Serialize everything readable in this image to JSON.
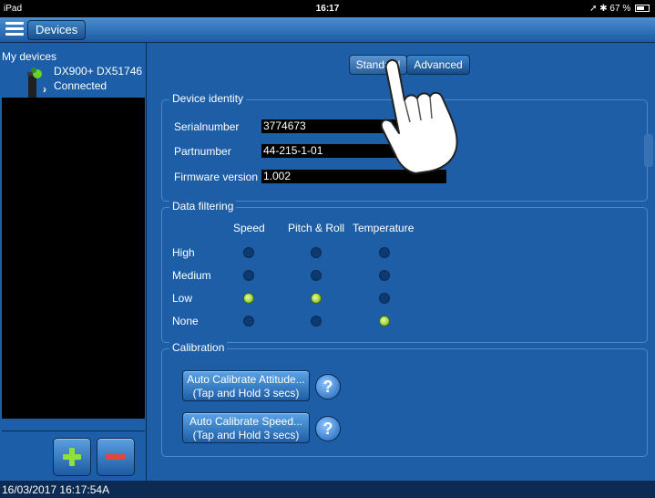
{
  "status_bar": {
    "device": "iPad",
    "time": "16:17",
    "battery": "67 %"
  },
  "toolbar": {
    "devices_label": "Devices"
  },
  "sidebar": {
    "title": "My devices",
    "device_name": "DX900+ DX51746",
    "device_status": "Connected"
  },
  "main": {
    "tabs": [
      "Standard",
      "Advanced"
    ],
    "identity": {
      "title": "Device identity",
      "rows": [
        {
          "label": "Serialnumber",
          "value": "3774673"
        },
        {
          "label": "Partnumber",
          "value": "44-215-1-01"
        },
        {
          "label": "Firmware version",
          "value": "1.002"
        }
      ]
    },
    "filtering": {
      "title": "Data filtering",
      "columns": [
        "Speed",
        "Pitch & Roll",
        "Temperature"
      ],
      "rows": [
        "High",
        "Medium",
        "Low",
        "None"
      ],
      "selected": {
        "Speed": "Low",
        "Pitch & Roll": "Low",
        "Temperature": "None"
      }
    },
    "calibration": {
      "title": "Calibration",
      "attitude_line1": "Auto Calibrate Attitude...",
      "attitude_line2": "(Tap and Hold 3 secs)",
      "speed_line1": "Auto Calibrate Speed...",
      "speed_line2": "(Tap and Hold 3 secs)",
      "help": "?"
    }
  },
  "footer": {
    "timestamp": "16/03/2017 16:17:54A"
  },
  "icons": {
    "menu": "hamburger-icon",
    "device": "sensor-device-icon",
    "add": "plus-icon",
    "remove": "minus-icon",
    "help": "help-icon",
    "hand": "hand-pointer-icon"
  },
  "colors": {
    "panel": "#1d5ea6",
    "selected_dot": "#9ed13c",
    "add_green": "#8ee03b",
    "remove_red": "#e3463b"
  }
}
